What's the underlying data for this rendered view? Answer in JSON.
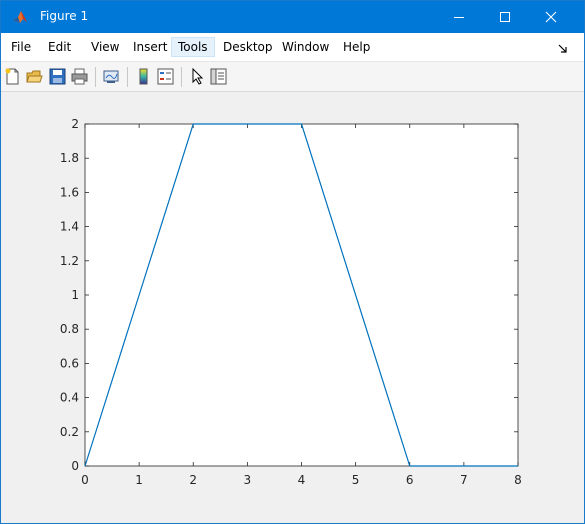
{
  "window": {
    "title": "Figure 1",
    "icon": "matlab-logo-icon",
    "controls": [
      "minimize-icon",
      "maximize-icon",
      "close-icon"
    ]
  },
  "menu": {
    "items": [
      "File",
      "Edit",
      "View",
      "Insert",
      "Tools",
      "Desktop",
      "Window",
      "Help"
    ],
    "active": "Tools"
  },
  "toolbar": {
    "icons": [
      "new-figure-icon",
      "open-file-icon",
      "save-icon",
      "print-icon",
      "link-plot-icon",
      "colorbar-icon",
      "legend-icon",
      "edit-plot-arrow-icon",
      "property-inspector-icon"
    ]
  },
  "colors": {
    "titlebar": "#0078d7",
    "line": "#0072bd",
    "axes_bg": "#ffffff",
    "figure_bg": "#f0f0f0"
  },
  "chart_data": {
    "type": "line",
    "title": "",
    "xlabel": "",
    "ylabel": "",
    "xlim": [
      0,
      8
    ],
    "ylim": [
      0,
      2
    ],
    "x_ticks": [
      "0",
      "1",
      "2",
      "3",
      "4",
      "5",
      "6",
      "7",
      "8"
    ],
    "y_ticks": [
      "0",
      "0.2",
      "0.4",
      "0.6",
      "0.8",
      "1",
      "1.2",
      "1.4",
      "1.6",
      "1.8",
      "2"
    ],
    "grid": false,
    "series": [
      {
        "x": [
          0,
          2,
          4,
          6,
          8
        ],
        "y": [
          0,
          2,
          2,
          0,
          0
        ]
      }
    ]
  }
}
